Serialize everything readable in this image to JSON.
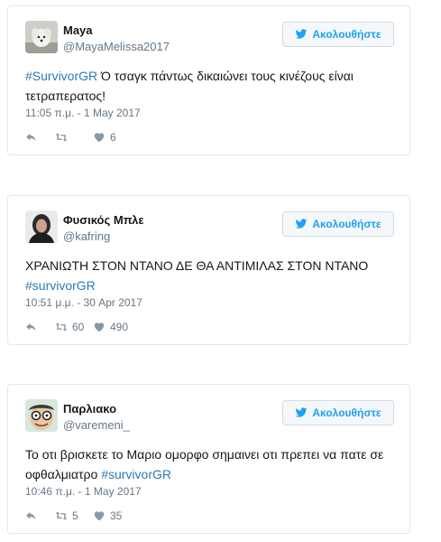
{
  "tweets": [
    {
      "name": "Maya",
      "handle": "@MayaMelissa2017",
      "follow_label": "Ακολουθήστε",
      "text_parts": [
        "#SurvivorGR",
        " Ό τσαγκ πάντως δικαιώνει τους κινέζους είναι τετραπερατος!"
      ],
      "time": "11:05 π.μ. - 1 May 2017",
      "retweets": "",
      "likes": "6"
    },
    {
      "name": "Φυσικός Μπλε",
      "handle": "@kafring",
      "follow_label": "Ακολουθήστε",
      "text_parts": [
        "ΧΡΑΝΙΩΤΗ ΣΤΟΝ ΝΤΑΝΟ ΔΕ ΘΑ ΑΝΤΙΜΙΛΑΣ ΣΤΟΝ ΝΤΑΝΟ ",
        "#survivorGR"
      ],
      "time": "10:51 μ.μ. - 30 Apr 2017",
      "retweets": "60",
      "likes": "490"
    },
    {
      "name": "Παρλιακο",
      "handle": "@varemeni_",
      "follow_label": "Ακολουθήστε",
      "text_parts": [
        "Το οτι βρισκετε το Μαριο ομορφο σημαινει οτι πρεπει να πατε σε οφθαλμιατρο ",
        "#survivorGR"
      ],
      "time": "10:46 π.μ. - 1 May 2017",
      "retweets": "5",
      "likes": "35"
    }
  ],
  "colors": {
    "accent": "#1da1f2",
    "hashtag": "#2b7bb9",
    "muted": "#657786",
    "border": "#e1e8ed"
  },
  "icons": [
    "twitter-bird-icon",
    "reply-icon",
    "retweet-icon",
    "heart-icon"
  ]
}
